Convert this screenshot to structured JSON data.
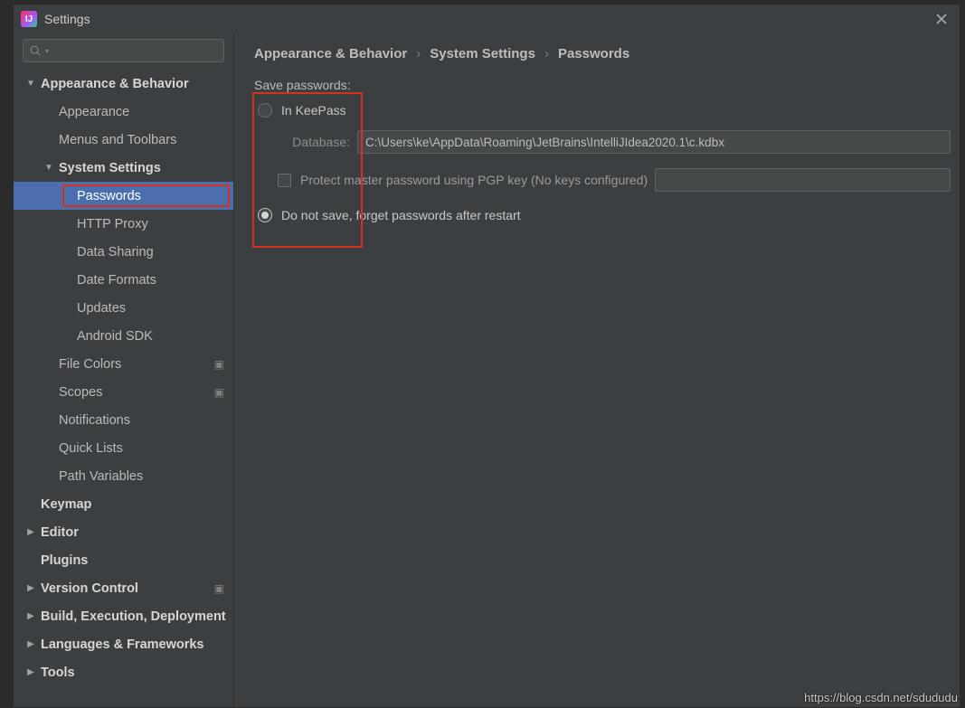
{
  "window": {
    "title": "Settings"
  },
  "breadcrumb": {
    "a": "Appearance & Behavior",
    "sep": "›",
    "b": "System Settings",
    "c": "Passwords"
  },
  "passwords": {
    "section_label": "Save passwords:",
    "radio_in_keepass": "In KeePass",
    "database_label": "Database:",
    "database_value": "C:\\Users\\ke\\AppData\\Roaming\\JetBrains\\IntelliJIdea2020.1\\c.kdbx",
    "pgp_label": "Protect master password using PGP key (No keys configured)",
    "radio_do_not_save": "Do not save, forget passwords after restart",
    "selected_option": "do_not_save"
  },
  "sidebar": [
    {
      "label": "Appearance & Behavior",
      "depth": 0,
      "bold": true,
      "expanded": true
    },
    {
      "label": "Appearance",
      "depth": 1
    },
    {
      "label": "Menus and Toolbars",
      "depth": 1
    },
    {
      "label": "System Settings",
      "depth": 1,
      "bold": true,
      "expanded": true
    },
    {
      "label": "Passwords",
      "depth": 2,
      "selected": true
    },
    {
      "label": "HTTP Proxy",
      "depth": 2
    },
    {
      "label": "Data Sharing",
      "depth": 2
    },
    {
      "label": "Date Formats",
      "depth": 2
    },
    {
      "label": "Updates",
      "depth": 2
    },
    {
      "label": "Android SDK",
      "depth": 2
    },
    {
      "label": "File Colors",
      "depth": 1,
      "shared": true
    },
    {
      "label": "Scopes",
      "depth": 1,
      "shared": true
    },
    {
      "label": "Notifications",
      "depth": 1
    },
    {
      "label": "Quick Lists",
      "depth": 1
    },
    {
      "label": "Path Variables",
      "depth": 1
    },
    {
      "label": "Keymap",
      "depth": 0,
      "bold": true
    },
    {
      "label": "Editor",
      "depth": 0,
      "bold": true,
      "collapsed": true
    },
    {
      "label": "Plugins",
      "depth": 0,
      "bold": true
    },
    {
      "label": "Version Control",
      "depth": 0,
      "bold": true,
      "collapsed": true,
      "shared": true
    },
    {
      "label": "Build, Execution, Deployment",
      "depth": 0,
      "bold": true,
      "collapsed": true
    },
    {
      "label": "Languages & Frameworks",
      "depth": 0,
      "bold": true,
      "collapsed": true
    },
    {
      "label": "Tools",
      "depth": 0,
      "bold": true,
      "collapsed": true
    }
  ],
  "watermark": "https://blog.csdn.net/sdududu"
}
